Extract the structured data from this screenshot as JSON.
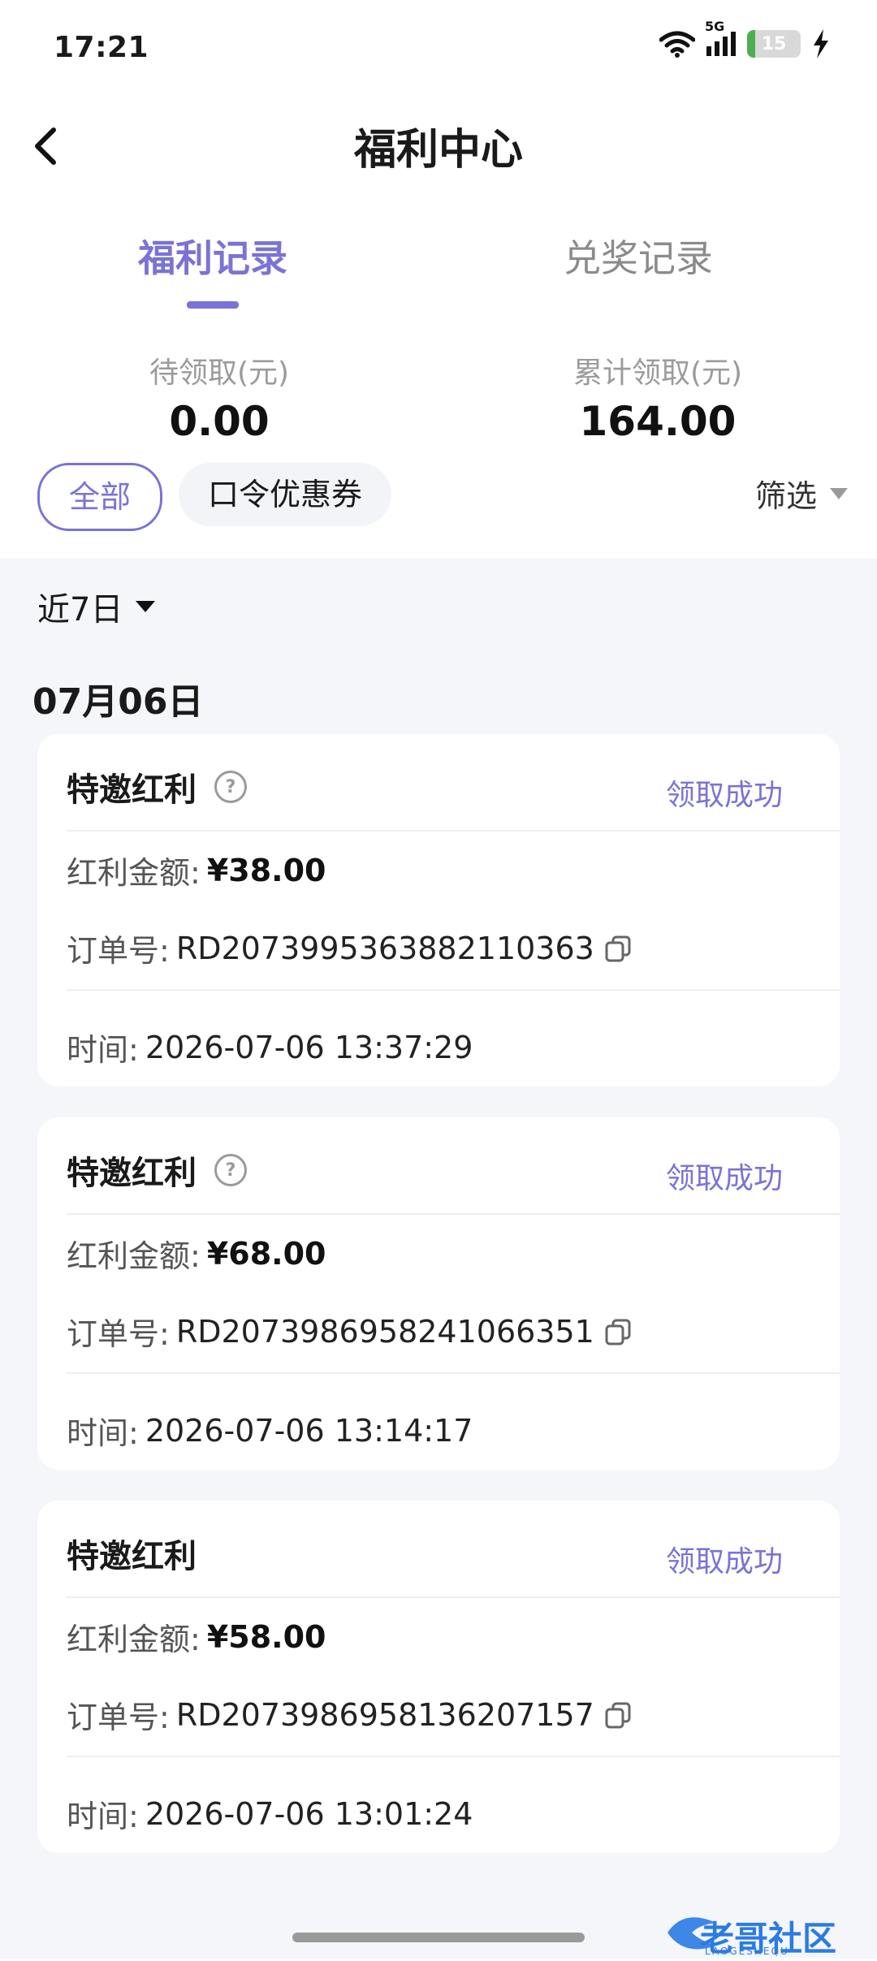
{
  "status_bar": {
    "time": "17:21",
    "network": "5G",
    "battery_level": "15",
    "icons": [
      "wifi-icon",
      "5g-signal-icon",
      "battery-icon",
      "charging-icon"
    ]
  },
  "header": {
    "title": "福利中心"
  },
  "tabs": [
    {
      "label": "福利记录",
      "active": true
    },
    {
      "label": "兑奖记录",
      "active": false
    }
  ],
  "summary": {
    "pending_label": "待领取(元)",
    "pending_value": "0.00",
    "total_label": "累计领取(元)",
    "total_value": "164.00"
  },
  "filters": {
    "chips": [
      {
        "label": "全部",
        "selected": true
      },
      {
        "label": "口令优惠券",
        "selected": false
      }
    ],
    "filter_label": "筛选"
  },
  "range": {
    "label": "近7日"
  },
  "date_heading": "07月06日",
  "records": [
    {
      "title": "特邀红利",
      "has_help": true,
      "status": "领取成功",
      "amount_label": "红利金额:",
      "amount": "¥38.00",
      "order_label": "订单号:",
      "order_no": "RD2073995363882110363",
      "time_label": "时间:",
      "time": "2026-07-06 13:37:29"
    },
    {
      "title": "特邀红利",
      "has_help": true,
      "status": "领取成功",
      "amount_label": "红利金额:",
      "amount": "¥68.00",
      "order_label": "订单号:",
      "order_no": "RD2073986958241066351",
      "time_label": "时间:",
      "time": "2026-07-06 13:14:17"
    },
    {
      "title": "特邀红利",
      "has_help": false,
      "status": "领取成功",
      "amount_label": "红利金额:",
      "amount": "¥58.00",
      "order_label": "订单号:",
      "order_no": "RD2073986958136207157",
      "time_label": "时间:",
      "time": "2026-07-06 13:01:24"
    }
  ],
  "watermark": {
    "text": "老哥社区",
    "sub": "LAOGESHEQU"
  },
  "colors": {
    "accent": "#7a73d6",
    "background_list": "#f5f6fa",
    "card": "#ffffff",
    "text_primary": "#1a1a1a",
    "text_secondary": "#9b9b9b"
  }
}
